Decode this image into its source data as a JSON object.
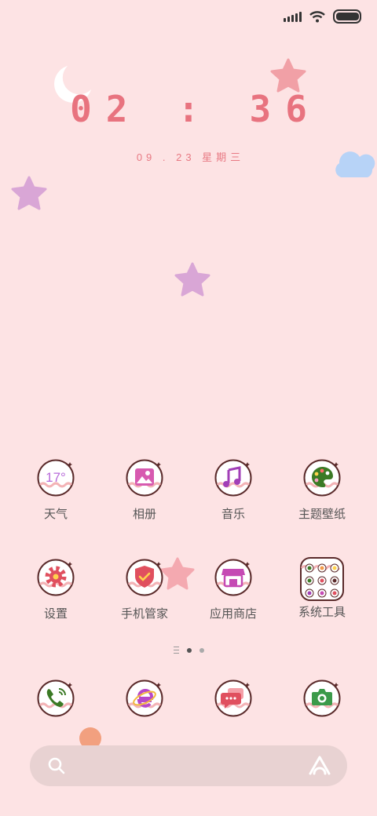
{
  "clock": {
    "time": "02 : 36",
    "date": "09 . 23  星期三"
  },
  "weather_temp": "17°",
  "apps_row1": [
    {
      "label": "天气"
    },
    {
      "label": "相册"
    },
    {
      "label": "音乐"
    },
    {
      "label": "主题壁纸"
    }
  ],
  "apps_row2": [
    {
      "label": "设置"
    },
    {
      "label": "手机管家"
    },
    {
      "label": "应用商店"
    },
    {
      "label": "系统工具"
    }
  ],
  "dock": [
    {
      "icon": "phone-icon"
    },
    {
      "icon": "browser-icon"
    },
    {
      "icon": "messages-icon"
    },
    {
      "icon": "camera-icon"
    }
  ],
  "page_indicator": {
    "pages": 2,
    "current": 1
  },
  "colors": {
    "background": "#fde3e4",
    "accent": "#e8737f"
  }
}
